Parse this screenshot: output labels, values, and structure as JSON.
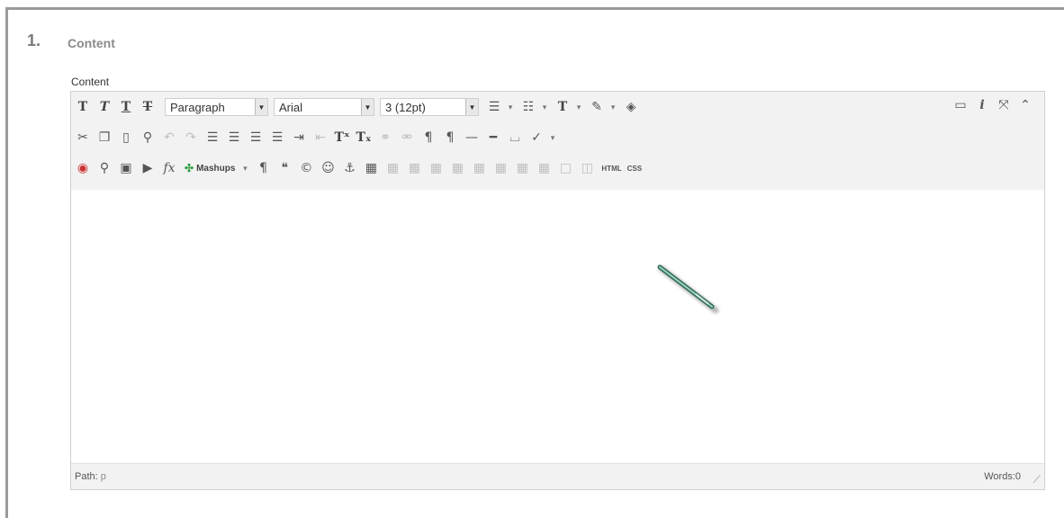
{
  "step": {
    "number": "1.",
    "title": "Content"
  },
  "field_label": "Content",
  "toolbar": {
    "row1_icons": [
      "bold-icon",
      "italic-icon",
      "underline-icon",
      "strikethrough-icon"
    ],
    "format_select": "Paragraph",
    "font_select": "Arial",
    "size_select": "3 (12pt)",
    "row1_extra": [
      "bullet-list-icon",
      "numbered-list-icon",
      "text-color-icon",
      "highlight-icon",
      "eraser-icon"
    ],
    "right_tools": [
      "preview-icon",
      "info-icon",
      "fullscreen-icon",
      "collapse-icon"
    ],
    "row2": [
      "cut-icon",
      "copy-icon",
      "paste-icon",
      "find-icon",
      "undo-icon",
      "redo-icon",
      "align-left-icon",
      "align-center-icon",
      "align-right-icon",
      "justify-icon",
      "indent-icon",
      "outdent-icon",
      "superscript-icon",
      "subscript-icon",
      "link-icon",
      "unlink-icon",
      "ltr-icon",
      "rtl-icon",
      "hr-icon",
      "hr-thick-icon",
      "nbsp-icon",
      "spellcheck-icon"
    ],
    "mashups_label": "Mashups",
    "html_label": "HTML",
    "css_label": "CSS"
  },
  "status": {
    "path_label": "Path:",
    "path_value": "p",
    "words": "Words:0"
  }
}
